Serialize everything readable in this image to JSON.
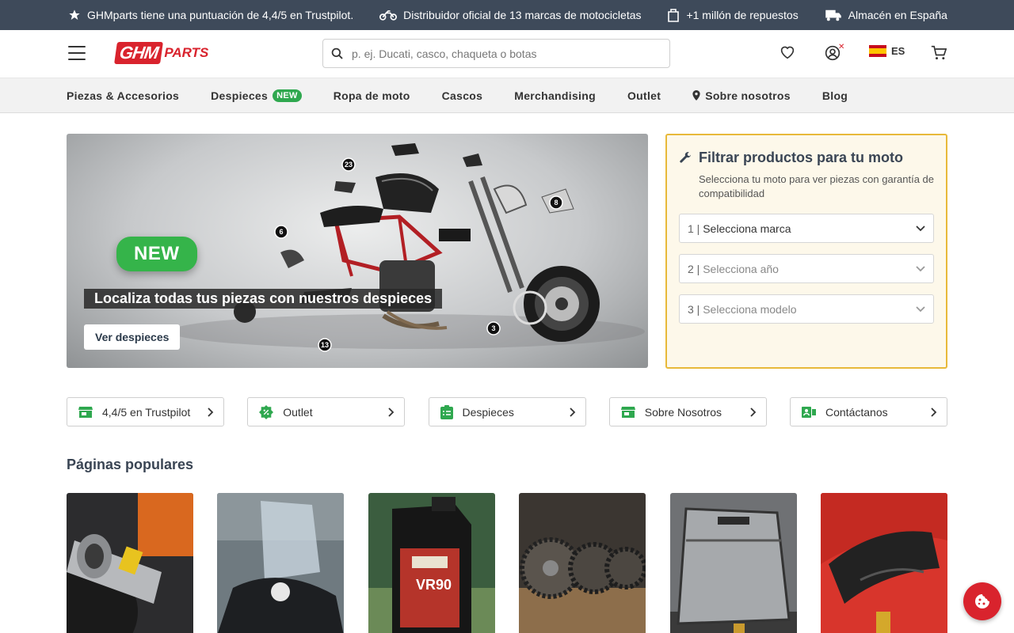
{
  "topbar": {
    "items": [
      {
        "label": "GHMparts tiene una puntuación de 4,4/5 en Trustpilot.",
        "icon": "star-icon"
      },
      {
        "label": "Distribuidor oficial de 13 marcas de motocicletas",
        "icon": "motorcycle-icon"
      },
      {
        "label": "+1 millón de repuestos",
        "icon": "bag-icon"
      },
      {
        "label": "Almacén en España",
        "icon": "truck-icon"
      }
    ]
  },
  "header": {
    "logo_main": "GHM",
    "logo_sub": "PARTS",
    "search_placeholder": "p. ej. Ducati, casco, chaqueta o botas",
    "lang": "ES"
  },
  "nav": {
    "items": [
      {
        "label": "Piezas & Accesorios"
      },
      {
        "label": "Despieces",
        "badge": "NEW"
      },
      {
        "label": "Ropa de moto"
      },
      {
        "label": "Cascos"
      },
      {
        "label": "Merchandising"
      },
      {
        "label": "Outlet"
      },
      {
        "label": "Sobre nosotros",
        "icon": "location-pin-icon"
      },
      {
        "label": "Blog"
      }
    ]
  },
  "hero": {
    "badge": "NEW",
    "title": "Localiza todas tus piezas con nuestros despieces",
    "button": "Ver despieces",
    "callouts": [
      "23",
      "8",
      "6",
      "3",
      "13"
    ]
  },
  "filter": {
    "title": "Filtrar productos para tu moto",
    "subtitle": "Selecciona tu moto para ver piezas con garantía de compatibilidad",
    "selects": [
      {
        "num": "1 |",
        "label": "Selecciona marca"
      },
      {
        "num": "2 |",
        "label": "Selecciona año"
      },
      {
        "num": "3 |",
        "label": "Selecciona modelo"
      }
    ]
  },
  "quick_links": [
    {
      "label": "4,4/5 en Trustpilot",
      "icon": "store-icon"
    },
    {
      "label": "Outlet",
      "icon": "discount-badge-icon"
    },
    {
      "label": "Despieces",
      "icon": "clipboard-icon"
    },
    {
      "label": "Sobre Nosotros",
      "icon": "store-icon"
    },
    {
      "label": "Contáctanos",
      "icon": "contact-icon"
    }
  ],
  "popular": {
    "title": "Páginas populares"
  },
  "colors": {
    "brand_red": "#d9232d",
    "topbar_bg": "#3e4a5a",
    "accent_green": "#2fa84f",
    "filter_border": "#e8b93a"
  }
}
